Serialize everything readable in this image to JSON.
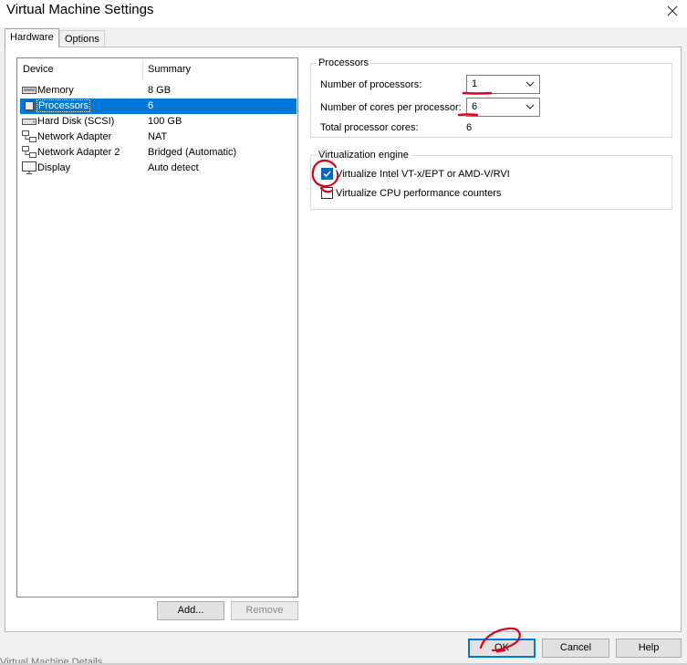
{
  "window": {
    "title": "Virtual Machine Settings"
  },
  "tabs": [
    {
      "label": "Hardware",
      "active": true
    },
    {
      "label": "Options",
      "active": false
    }
  ],
  "device_list": {
    "columns": {
      "device": "Device",
      "summary": "Summary"
    },
    "rows": [
      {
        "icon": "memory-icon",
        "device": "Memory",
        "summary": "8 GB",
        "selected": false
      },
      {
        "icon": "processor-icon",
        "device": "Processors",
        "summary": "6",
        "selected": true
      },
      {
        "icon": "hard-disk-icon",
        "device": "Hard Disk (SCSI)",
        "summary": "100 GB",
        "selected": false
      },
      {
        "icon": "network-adapter-icon",
        "device": "Network Adapter",
        "summary": "NAT",
        "selected": false
      },
      {
        "icon": "network-adapter-icon",
        "device": "Network Adapter 2",
        "summary": "Bridged (Automatic)",
        "selected": false
      },
      {
        "icon": "display-icon",
        "device": "Display",
        "summary": "Auto detect",
        "selected": false
      }
    ],
    "add_label": "Add...",
    "remove_label": "Remove"
  },
  "processors": {
    "group_label": "Processors",
    "num_processors_label": "Number of processors:",
    "num_processors_value": "1",
    "cores_per_processor_label": "Number of cores per processor:",
    "cores_per_processor_value": "6",
    "total_cores_label": "Total processor cores:",
    "total_cores_value": "6"
  },
  "virtualization": {
    "group_label": "Virtualization engine",
    "vtx_label": "Virtualize Intel VT-x/EPT or AMD-V/RVI",
    "vtx_checked": true,
    "perf_counters_label": "Virtualize CPU performance counters",
    "perf_counters_checked": false
  },
  "footer": {
    "ok_label": "OK",
    "cancel_label": "Cancel",
    "help_label": "Help"
  },
  "colors": {
    "selection": "#0078d7",
    "checkbox": "#0067c0",
    "annotation": "#e0001b"
  },
  "background_text": "Virtual Machine Details"
}
